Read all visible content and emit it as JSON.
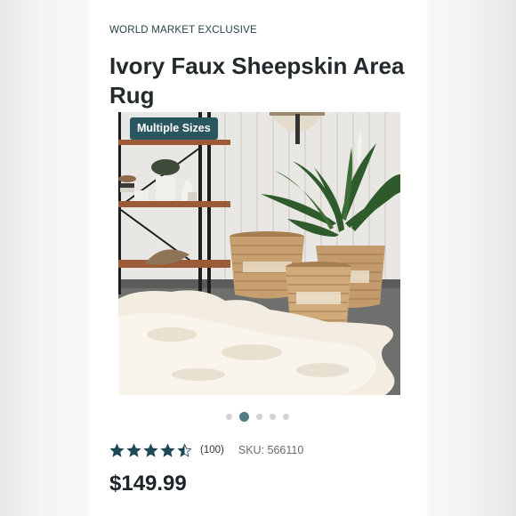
{
  "product": {
    "eyebrow": "WORLD MARKET EXCLUSIVE",
    "title": "Ivory Faux Sheepskin Area Rug",
    "badge": "Multiple Sizes",
    "image_alt": "Ivory faux sheepskin rug with seagrass baskets and potted plant",
    "carousel": {
      "total": 5,
      "active": 2
    },
    "rating": {
      "value": 4.5,
      "max": 5,
      "reviews_label": "(100)"
    },
    "sku_label": "SKU: 566110",
    "price": "$149.99"
  },
  "colors": {
    "accent": "#2a5660",
    "star": "#1f4a55",
    "text": "#222a2c"
  }
}
